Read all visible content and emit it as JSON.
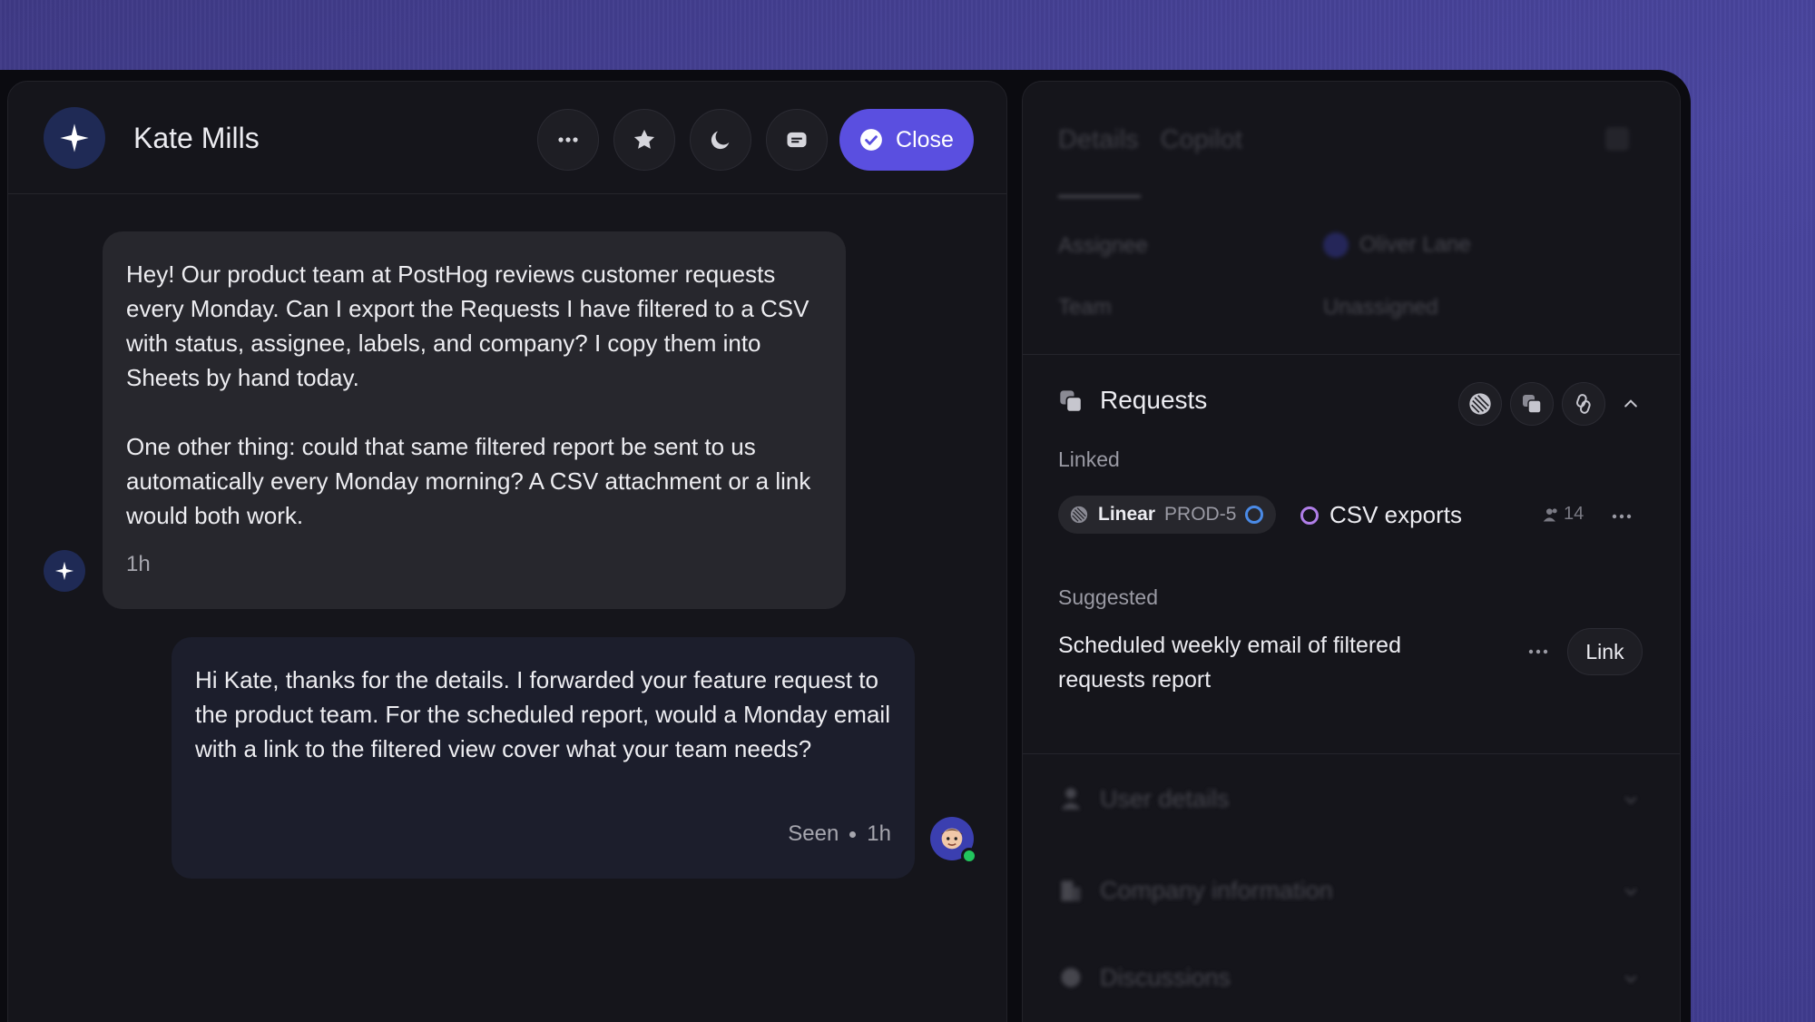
{
  "conversation": {
    "contact_name": "Kate Mills",
    "header_actions": [
      "more-options",
      "star",
      "snooze",
      "convert-to-ticket"
    ],
    "close_label": "Close",
    "messages": [
      {
        "paragraphs": [
          "Hey! Our product team at PostHog reviews customer requests every Monday. Can I export the Requests I have filtered to a CSV with status, assignee, labels, and company? I copy them into Sheets by hand today.",
          "One other thing: could that same filtered report be sent to us automatically every Monday morning? A CSV attachment or a link would both work."
        ],
        "time": "1h"
      },
      {
        "text": "Hi Kate, thanks for the details. I forwarded your feature request to the product team. For the scheduled report, would a Monday email with a link to the filtered view cover what your team needs?",
        "seen_label": "Seen",
        "time": "1h"
      }
    ]
  },
  "sidebar": {
    "tabs": [
      "Details",
      "Copilot"
    ],
    "assignee_label": "Assignee",
    "assignee_value": "Oliver Lane",
    "team_label": "Team",
    "team_value": "Unassigned",
    "requests": {
      "title": "Requests",
      "linked_label": "Linked",
      "linked": {
        "source": "Linear",
        "id": "PROD-5",
        "title": "CSV exports",
        "votes": "14"
      },
      "suggested_label": "Suggested",
      "suggested": {
        "title": "Scheduled weekly email of filtered requests report",
        "link_label": "Link"
      }
    },
    "sections": [
      "User details",
      "Company information",
      "Discussions"
    ]
  },
  "colors": {
    "accent": "#5a4fe0",
    "background": "#0b0b10",
    "panel": "#15151b",
    "incoming_bubble": "#27272d",
    "outgoing_bubble": "#1c1e2c",
    "linked_status": "#b07ee8",
    "linear_status": "#4a8ae6"
  }
}
